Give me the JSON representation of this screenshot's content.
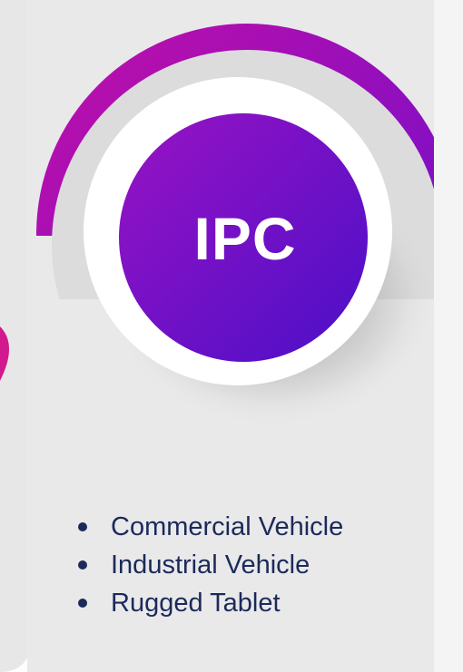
{
  "card": {
    "title": "IPC",
    "items": [
      "Commercial Vehicle",
      "Industrial Vehicle",
      "Rugged Tablet"
    ]
  },
  "colors": {
    "accent_start": "#c20fa8",
    "accent_end": "#4b0fc7",
    "text": "#1c2a5a",
    "panel": "#e9e9ea",
    "background": "#f4f4f4"
  },
  "icons": [
    "bullet-dot"
  ]
}
